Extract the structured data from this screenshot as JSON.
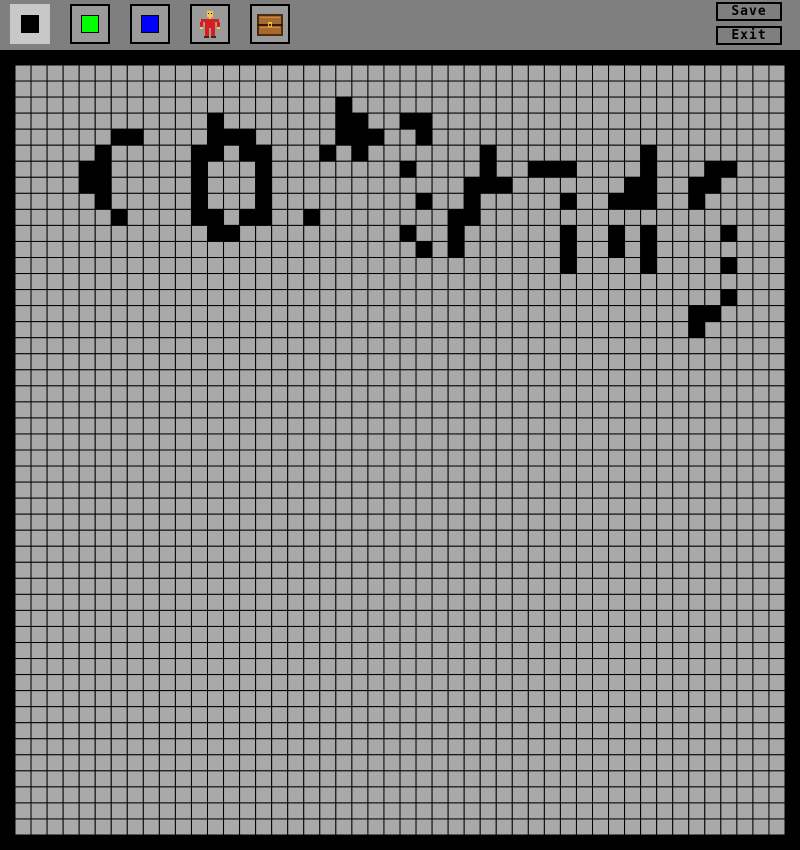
{
  "toolbar": {
    "tools": [
      {
        "name": "black",
        "color": "#000000",
        "selected": true
      },
      {
        "name": "green",
        "color": "#00ff00",
        "selected": false
      },
      {
        "name": "blue",
        "color": "#0000ff",
        "selected": false
      },
      {
        "name": "player-sprite",
        "icon": "character-icon",
        "selected": false
      },
      {
        "name": "treasure-chest",
        "icon": "chest-icon",
        "selected": false
      }
    ],
    "save_label": "Save",
    "exit_label": "Exit"
  },
  "grid": {
    "columns": 48,
    "rows": 48,
    "empty_color": "#a9a9a9",
    "line_color": "#000000",
    "filled_color": "#000000",
    "filled_cells": [
      [
        20,
        2
      ],
      [
        12,
        3
      ],
      [
        20,
        3
      ],
      [
        21,
        3
      ],
      [
        24,
        3
      ],
      [
        25,
        3
      ],
      [
        6,
        4
      ],
      [
        7,
        4
      ],
      [
        12,
        4
      ],
      [
        13,
        4
      ],
      [
        14,
        4
      ],
      [
        20,
        4
      ],
      [
        21,
        4
      ],
      [
        22,
        4
      ],
      [
        25,
        4
      ],
      [
        5,
        5
      ],
      [
        11,
        5
      ],
      [
        12,
        5
      ],
      [
        14,
        5
      ],
      [
        15,
        5
      ],
      [
        19,
        5
      ],
      [
        21,
        5
      ],
      [
        29,
        5
      ],
      [
        39,
        5
      ],
      [
        4,
        6
      ],
      [
        5,
        6
      ],
      [
        11,
        6
      ],
      [
        15,
        6
      ],
      [
        24,
        6
      ],
      [
        29,
        6
      ],
      [
        32,
        6
      ],
      [
        33,
        6
      ],
      [
        34,
        6
      ],
      [
        39,
        6
      ],
      [
        43,
        6
      ],
      [
        44,
        6
      ],
      [
        4,
        7
      ],
      [
        5,
        7
      ],
      [
        11,
        7
      ],
      [
        15,
        7
      ],
      [
        28,
        7
      ],
      [
        29,
        7
      ],
      [
        30,
        7
      ],
      [
        38,
        7
      ],
      [
        39,
        7
      ],
      [
        42,
        7
      ],
      [
        43,
        7
      ],
      [
        5,
        8
      ],
      [
        11,
        8
      ],
      [
        15,
        8
      ],
      [
        25,
        8
      ],
      [
        28,
        8
      ],
      [
        34,
        8
      ],
      [
        37,
        8
      ],
      [
        38,
        8
      ],
      [
        39,
        8
      ],
      [
        42,
        8
      ],
      [
        6,
        9
      ],
      [
        11,
        9
      ],
      [
        12,
        9
      ],
      [
        14,
        9
      ],
      [
        15,
        9
      ],
      [
        18,
        9
      ],
      [
        27,
        9
      ],
      [
        28,
        9
      ],
      [
        12,
        10
      ],
      [
        13,
        10
      ],
      [
        24,
        10
      ],
      [
        27,
        10
      ],
      [
        34,
        10
      ],
      [
        37,
        10
      ],
      [
        39,
        10
      ],
      [
        44,
        10
      ],
      [
        25,
        11
      ],
      [
        27,
        11
      ],
      [
        34,
        11
      ],
      [
        37,
        11
      ],
      [
        39,
        11
      ],
      [
        34,
        12
      ],
      [
        39,
        12
      ],
      [
        44,
        12
      ],
      [
        44,
        14
      ],
      [
        42,
        15
      ],
      [
        43,
        15
      ],
      [
        42,
        16
      ]
    ]
  }
}
